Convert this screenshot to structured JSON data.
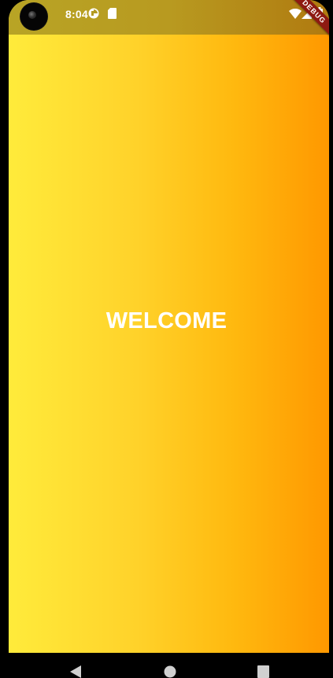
{
  "status_bar": {
    "time": "8:04",
    "debug_label": "DEBUG",
    "icons": [
      "photo-icon",
      "sd-card-icon",
      "wifi-icon",
      "signal-icon",
      "battery-icon"
    ]
  },
  "main": {
    "title": "WELCOME",
    "gradient_colors": [
      "#ffeb3b",
      "#ff9800"
    ]
  },
  "nav_bar": {
    "buttons": [
      "back-icon",
      "home-icon",
      "recents-icon"
    ]
  }
}
